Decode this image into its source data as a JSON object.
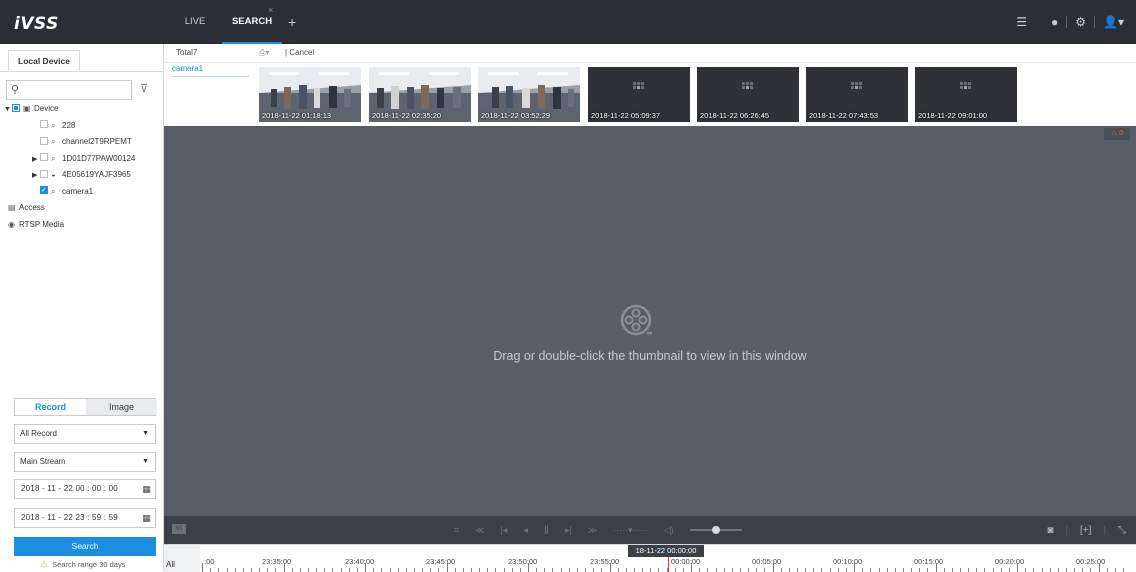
{
  "app": {
    "logo": "iVSS"
  },
  "tabs": {
    "live": "LIVE",
    "search": "SEARCH",
    "close": "×",
    "add": "+"
  },
  "top_icons": [
    "list-icon",
    "globe-icon",
    "settings-icon",
    "user-icon"
  ],
  "left_panel": {
    "tab": "Local Device",
    "search_placeholder": "",
    "tree": {
      "device": "Device",
      "children": [
        "228",
        "channel2T9RPEMT",
        "1D01D77PAW00124",
        "4E05619YAJF3965",
        "camera1"
      ],
      "access": "Access",
      "rtsp": "RTSP Media"
    },
    "mode_tabs": {
      "record": "Record",
      "image": "Image"
    },
    "record_type": "All Record",
    "stream": "Main Stream",
    "start_time": "2018 - 11 - 22  00 : 00 : 00",
    "end_time": "2018 - 11 - 22  23 : 59 : 59",
    "search_button": "Search",
    "warning": "Search range 30 days"
  },
  "results": {
    "total": "Total7",
    "cancel": "| Cancel",
    "camera": "camera1",
    "thumbnails": [
      "2018-11-22 01:18:13",
      "2018-11-22 02:35:20",
      "2018-11-22 03:52:29",
      "2018-11-22 05:09:37",
      "2018-11-22 06:26:45",
      "2018-11-22 07:43:53",
      "2018-11-22 09:01:00"
    ]
  },
  "player": {
    "message": "Drag or double-click the thumbnail to view in this window",
    "alarm_badge": "⚠ 0"
  },
  "timeline": {
    "all_label": "All",
    "current": "18-11-22  00:00:00",
    "labels": [
      "23:30:00",
      "23:35:00",
      "23:40:00",
      "23:45:00",
      "23:50:00",
      "23:55:00",
      "00:00:00",
      "00:05:00",
      "00:10:00",
      "00:15:00",
      "00:20:00",
      "00:25:00"
    ],
    "first_label_visible": ":00"
  },
  "colors": {
    "accent": "#1a8fe0",
    "topbar": "#2b2e35",
    "player_bg": "#585d67"
  }
}
